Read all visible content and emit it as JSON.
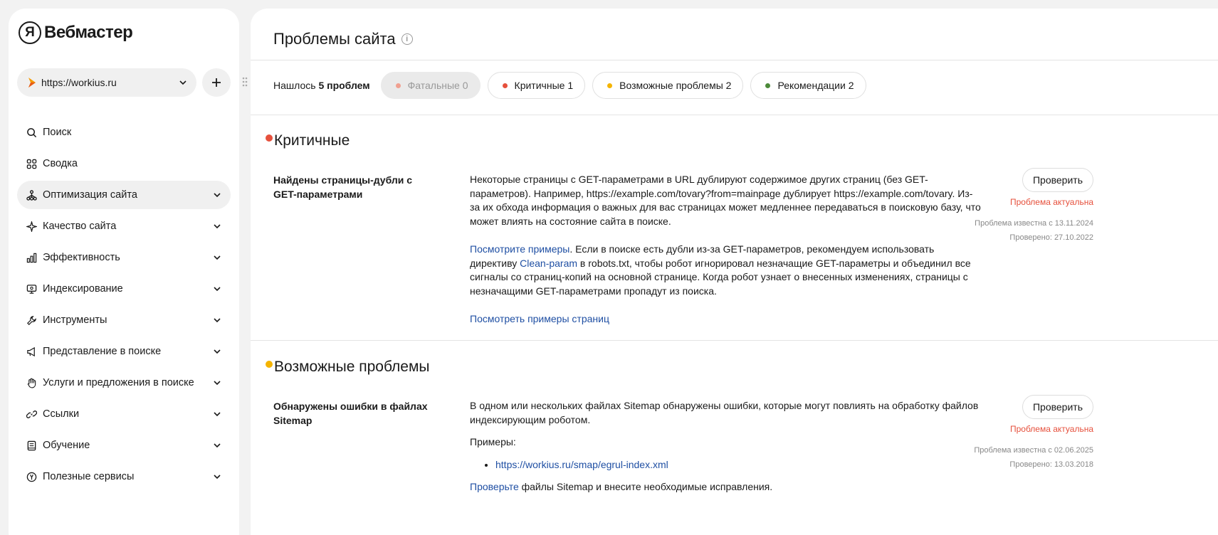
{
  "app": {
    "logo_mark": "Я",
    "logo_text": "Вебмастер"
  },
  "site": {
    "url": "https://workius.ru"
  },
  "nav": [
    {
      "label": "Поиск",
      "icon": "search-icon",
      "has_chevron": false,
      "active": false
    },
    {
      "label": "Сводка",
      "icon": "grid-icon",
      "has_chevron": false,
      "active": false
    },
    {
      "label": "Оптимизация сайта",
      "icon": "sitemap-icon",
      "has_chevron": true,
      "active": true
    },
    {
      "label": "Качество сайта",
      "icon": "sparkle-icon",
      "has_chevron": true,
      "active": false
    },
    {
      "label": "Эффективность",
      "icon": "bar-chart-icon",
      "has_chevron": true,
      "active": false
    },
    {
      "label": "Индексирование",
      "icon": "monitor-icon",
      "has_chevron": true,
      "active": false
    },
    {
      "label": "Инструменты",
      "icon": "wrench-icon",
      "has_chevron": true,
      "active": false
    },
    {
      "label": "Представление в поиске",
      "icon": "megaphone-icon",
      "has_chevron": true,
      "active": false
    },
    {
      "label": "Услуги и предложения в поиске",
      "icon": "hand-icon",
      "has_chevron": true,
      "active": false
    },
    {
      "label": "Ссылки",
      "icon": "link-icon",
      "has_chevron": true,
      "active": false
    },
    {
      "label": "Обучение",
      "icon": "book-icon",
      "has_chevron": true,
      "active": false
    },
    {
      "label": "Полезные сервисы",
      "icon": "yandex-circle-icon",
      "has_chevron": true,
      "active": false
    }
  ],
  "page": {
    "title": "Проблемы сайта",
    "found_prefix": "Нашлось",
    "found_count": "5 проблем"
  },
  "filters": [
    {
      "label": "Фатальные",
      "count": "0",
      "color": "#f0a090",
      "disabled": true
    },
    {
      "label": "Критичные",
      "count": "1",
      "color": "#e6503c",
      "disabled": false
    },
    {
      "label": "Возможные проблемы",
      "count": "2",
      "color": "#f5b400",
      "disabled": false
    },
    {
      "label": "Рекомендации",
      "count": "2",
      "color": "#4c8a3a",
      "disabled": false
    }
  ],
  "sections": {
    "critical": {
      "title": "Критичные",
      "color": "#e6503c",
      "problem": {
        "name": "Найдены страницы-дубли с GET-параметрами",
        "desc1": "Некоторые страницы с GET-параметрами в URL дублируют содержимое других страниц (без GET-параметров). Например, https://example.com/tovary?from=mainpage дублирует https://example.com/tovary. Из-за их обхода информация о важных для вас страницах может медленнее передаваться в поисковую базу, что может влиять на состояние сайта в поиске.",
        "link1": "Посмотрите примеры",
        "desc2a": ". Если в поиске есть дубли из-за GET-параметров, рекомендуем использовать директиву ",
        "link2": "Clean-param",
        "desc2b": " в robots.txt, чтобы робот игнорировал незначащие GET-параметры и объединил все сигналы со страниц-копий на основной странице. Когда робот узнает о внесенных изменениях, страницы с незначащими GET-параметрами пропадут из поиска.",
        "link3": "Посмотреть примеры страниц",
        "check_label": "Проверить",
        "status": "Проблема актуальна",
        "known_since": "Проблема известна с 13.11.2024",
        "checked": "Проверено: 27.10.2022"
      }
    },
    "possible": {
      "title": "Возможные проблемы",
      "color": "#f5b400",
      "problem": {
        "name": "Обнаружены ошибки в файлах Sitemap",
        "desc1": "В одном или нескольких файлах Sitemap обнаружены ошибки, которые могут повлиять на обработку файлов индексирующим роботом.",
        "examples_label": "Примеры:",
        "example_link": "https://workius.ru/smap/egrul-index.xml",
        "link_check": "Проверьте",
        "desc_tail": " файлы Sitemap и внесите необходимые исправления.",
        "check_label": "Проверить",
        "status": "Проблема актуальна",
        "known_since": "Проблема известна с 02.06.2025",
        "checked": "Проверено: 13.03.2018"
      }
    }
  }
}
